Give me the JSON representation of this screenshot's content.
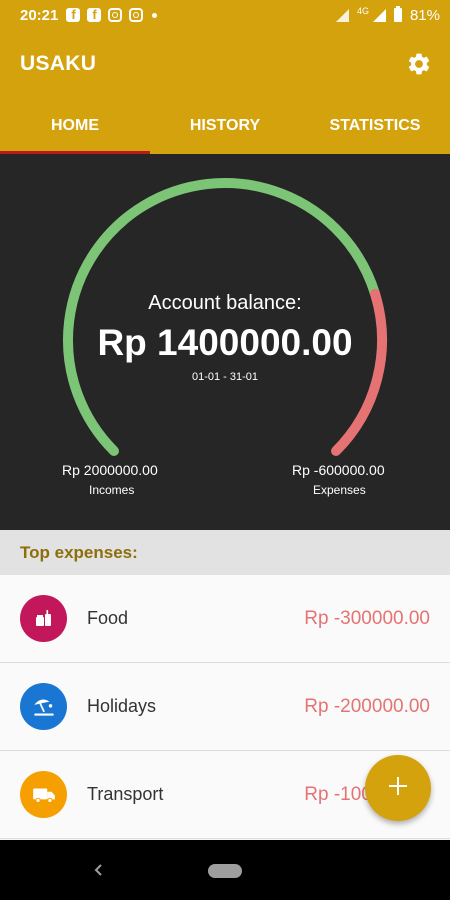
{
  "status_bar": {
    "time": "20:21",
    "network": "4G",
    "battery": "81%",
    "notification_icons": [
      "facebook-icon",
      "facebook-icon",
      "instagram-icon",
      "instagram-icon",
      "dot-icon"
    ]
  },
  "app_bar": {
    "title": "USAKU",
    "settings_icon": "gear-icon"
  },
  "tabs": [
    {
      "label": "HOME",
      "active": true
    },
    {
      "label": "HISTORY",
      "active": false
    },
    {
      "label": "STATISTICS",
      "active": false
    }
  ],
  "balance": {
    "caption": "Account balance:",
    "value": "Rp 1400000.00",
    "range": "01-01 - 31-01",
    "incomes_value": "Rp 2000000.00",
    "incomes_label": "Incomes",
    "expenses_value": "Rp -600000.00",
    "expenses_label": "Expenses",
    "income_fraction": 0.77,
    "income_color": "#7cc576",
    "expense_color": "#e57373"
  },
  "top_expenses": {
    "header": "Top expenses:",
    "items": [
      {
        "label": "Food",
        "amount": "Rp -300000.00",
        "icon": "food-icon",
        "color": "#c2185b"
      },
      {
        "label": "Holidays",
        "amount": "Rp -200000.00",
        "icon": "beach-umbrella-icon",
        "color": "#1976d2"
      },
      {
        "label": "Transport",
        "amount": "Rp -100000.00",
        "icon": "truck-icon",
        "color": "#f5a000"
      }
    ]
  },
  "fab": {
    "icon": "plus-icon"
  },
  "colors": {
    "primary": "#d4a20d",
    "panel": "#262626",
    "accent_tab": "#b71c1c"
  }
}
